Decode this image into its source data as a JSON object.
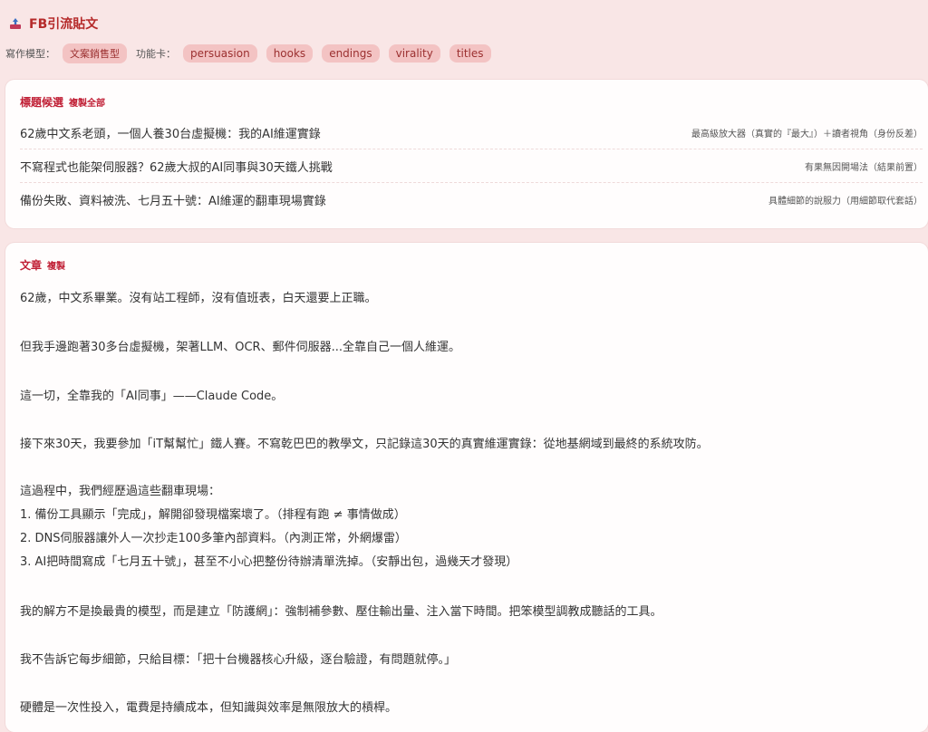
{
  "app": {
    "title": "FB引流貼文"
  },
  "toolbar": {
    "mode_label": "寫作模型：",
    "mode_value": "文案銷售型",
    "cards_label": "功能卡：",
    "cards": [
      "persuasion",
      "hooks",
      "endings",
      "virality",
      "titles"
    ]
  },
  "titles_card": {
    "title": "標題候選",
    "copy_all": "複製全部",
    "items": [
      {
        "text": "62歲中文系老頭，一個人養30台虛擬機：我的AI維運實錄",
        "note": "最高級放大器（真實的『最大』）＋讀者視角（身份反差）"
      },
      {
        "text": "不寫程式也能架伺服器？62歲大叔的AI同事與30天鐵人挑戰",
        "note": "有果無因開場法（結果前置）"
      },
      {
        "text": "備份失敗、資料被洗、七月五十號：AI維運的翻車現場實錄",
        "note": "具體細節的說服力（用細節取代套話）"
      }
    ]
  },
  "article_card": {
    "title": "文章",
    "copy": "複製",
    "lines": [
      "62歲，中文系畢業。沒有站工程師，沒有值班表，白天還要上正職。",
      "但我手邊跑著30多台虛擬機，架著LLM、OCR、郵件伺服器...全靠自己一個人維運。",
      "這一切，全靠我的「AI同事」——Claude Code。",
      "接下來30天，我要參加「iT幫幫忙」鐵人賽。不寫乾巴巴的教學文，只記錄這30天的真實維運實錄：從地基網域到最終的系統攻防。",
      "這過程中，我們經歷過這些翻車現場：",
      "1. 備份工具顯示「完成」，解開卻發現檔案壞了。（排程有跑 ≠ 事情做成）",
      "2. DNS伺服器讓外人一次抄走100多筆內部資料。（內測正常，外網爆雷）",
      "3. AI把時間寫成「七月五十號」，甚至不小心把整份待辦清單洗掉。（安靜出包，過幾天才發現）",
      "我的解方不是換最貴的模型，而是建立「防護網」：強制補參數、壓住輸出量、注入當下時間。把笨模型調教成聽話的工具。",
      "我不告訴它每步細節，只給目標：「把十台機器核心升級，逐台驗證，有問題就停。」",
      "硬體是一次性投入，電費是持續成本，但知識與效率是無限放大的槓桿。"
    ]
  }
}
